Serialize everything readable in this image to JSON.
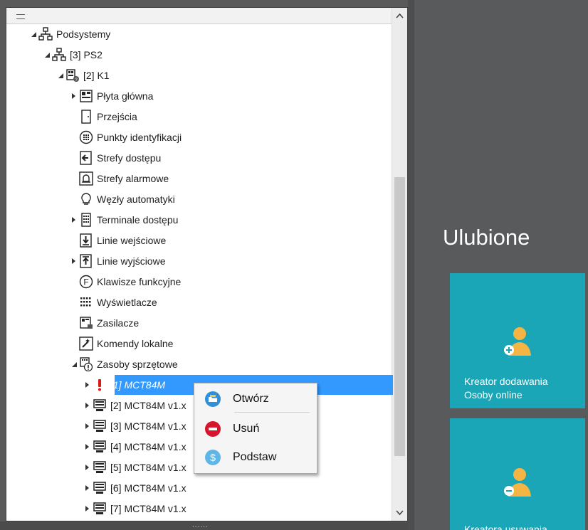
{
  "tree": {
    "items": [
      {
        "label": "Podsystemy",
        "icon": "network-icon",
        "expand": "expanded"
      },
      {
        "label": "[3] PS2",
        "icon": "network-icon",
        "expand": "expanded"
      },
      {
        "label": "[2] K1",
        "icon": "controller-icon",
        "expand": "expanded"
      },
      {
        "label": "Płyta główna",
        "icon": "board-icon",
        "expand": "collapsed"
      },
      {
        "label": "Przejścia",
        "icon": "door-icon",
        "expand": "none"
      },
      {
        "label": "Punkty identyfikacji",
        "icon": "keypad-circle-icon",
        "expand": "none"
      },
      {
        "label": "Strefy dostępu",
        "icon": "zone-enter-icon",
        "expand": "none"
      },
      {
        "label": "Strefy alarmowe",
        "icon": "alarm-bell-icon",
        "expand": "none"
      },
      {
        "label": "Węzły automatyki",
        "icon": "bulb-icon",
        "expand": "none"
      },
      {
        "label": "Terminale dostępu",
        "icon": "terminal-icon",
        "expand": "collapsed"
      },
      {
        "label": "Linie wejściowe",
        "icon": "input-line-icon",
        "expand": "none"
      },
      {
        "label": "Linie wyjściowe",
        "icon": "output-line-icon",
        "expand": "collapsed"
      },
      {
        "label": "Klawisze funkcyjne",
        "icon": "function-key-icon",
        "expand": "none"
      },
      {
        "label": "Wyświetlacze",
        "icon": "display-dots-icon",
        "expand": "none"
      },
      {
        "label": "Zasilacze",
        "icon": "power-supply-icon",
        "expand": "none"
      },
      {
        "label": "Komendy lokalne",
        "icon": "magic-wand-icon",
        "expand": "none"
      },
      {
        "label": "Zasoby sprzętowe",
        "icon": "hardware-warning-icon",
        "expand": "expanded"
      },
      {
        "label": "[1] MCT84M",
        "icon": "exclamation-icon",
        "expand": "collapsed",
        "selected": true
      },
      {
        "label": "[2] MCT84M v1.x",
        "icon": "computer-icon",
        "expand": "collapsed"
      },
      {
        "label": "[3] MCT84M v1.x",
        "icon": "computer-icon",
        "expand": "collapsed"
      },
      {
        "label": "[4] MCT84M v1.x",
        "icon": "computer-icon",
        "expand": "collapsed"
      },
      {
        "label": "[5] MCT84M v1.x",
        "icon": "computer-icon",
        "expand": "collapsed"
      },
      {
        "label": "[6] MCT84M v1.x",
        "icon": "computer-icon",
        "expand": "collapsed"
      },
      {
        "label": "[7] MCT84M v1.x",
        "icon": "computer-icon",
        "expand": "collapsed"
      }
    ]
  },
  "context_menu": {
    "items": [
      {
        "label": "Otwórz",
        "icon": "open-folder-icon"
      },
      {
        "label": "Usuń",
        "icon": "remove-circle-icon"
      },
      {
        "label": "Podstaw",
        "icon": "substitute-icon",
        "highlighted": true
      }
    ]
  },
  "favorites": {
    "title": "Ulubione",
    "tiles": [
      {
        "label_line1": "Kreator dodawania",
        "label_line2": "Osoby online",
        "icon": "add-user-icon"
      },
      {
        "label_line1": "Kreatora usuwania",
        "label_line2": "",
        "icon": "remove-user-icon"
      }
    ]
  },
  "statusbar": {
    "grip": "......"
  },
  "colors": {
    "accent": "#3399ff",
    "tile": "#1aa6b6",
    "highlight_border": "#e3202a",
    "user_icon": "#f5b544"
  }
}
